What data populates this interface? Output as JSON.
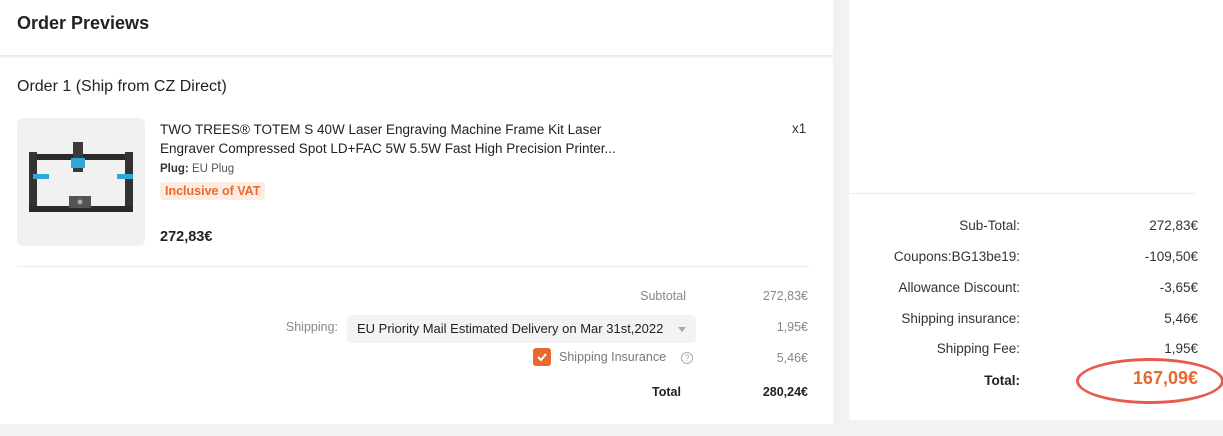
{
  "header": {
    "title": "Order Previews"
  },
  "order": {
    "title": "Order 1 (Ship from CZ Direct)",
    "product": {
      "name_line1": "TWO TREES® TOTEM S 40W Laser Engraving Machine Frame Kit Laser",
      "name_line2": "Engraver Compressed Spot LD+FAC 5W 5.5W Fast High Precision Printer...",
      "quantity": "x1",
      "variant_label": "Plug:",
      "variant_value": "EU Plug",
      "vat_badge": "Inclusive of VAT",
      "price": "272,83€"
    },
    "summary": {
      "subtotal_label": "Subtotal",
      "subtotal_value": "272,83€",
      "shipping_label": "Shipping:",
      "shipping_method": "EU Priority Mail Estimated Delivery on Mar 31st,2022",
      "shipping_value": "1,95€",
      "insurance_label": "Shipping Insurance",
      "insurance_checked": true,
      "insurance_value": "5,46€",
      "help_icon": "?",
      "total_label": "Total",
      "total_value": "280,24€"
    }
  },
  "summary_panel": {
    "rows": [
      {
        "label": "Sub-Total:",
        "value": "272,83€"
      },
      {
        "label": "Coupons:BG13be19:",
        "value": "-109,50€"
      },
      {
        "label": "Allowance Discount:",
        "value": "-3,65€"
      },
      {
        "label": "Shipping insurance:",
        "value": "5,46€"
      },
      {
        "label": "Shipping Fee:",
        "value": "1,95€"
      }
    ],
    "total_label": "Total:",
    "total_value": "167,09€"
  },
  "colors": {
    "accent": "#e8692e",
    "annotation": "#e85a4f"
  },
  "icons": {
    "checkbox": "check-icon",
    "help": "question-circle-icon",
    "dropdown": "caret-down-icon"
  }
}
